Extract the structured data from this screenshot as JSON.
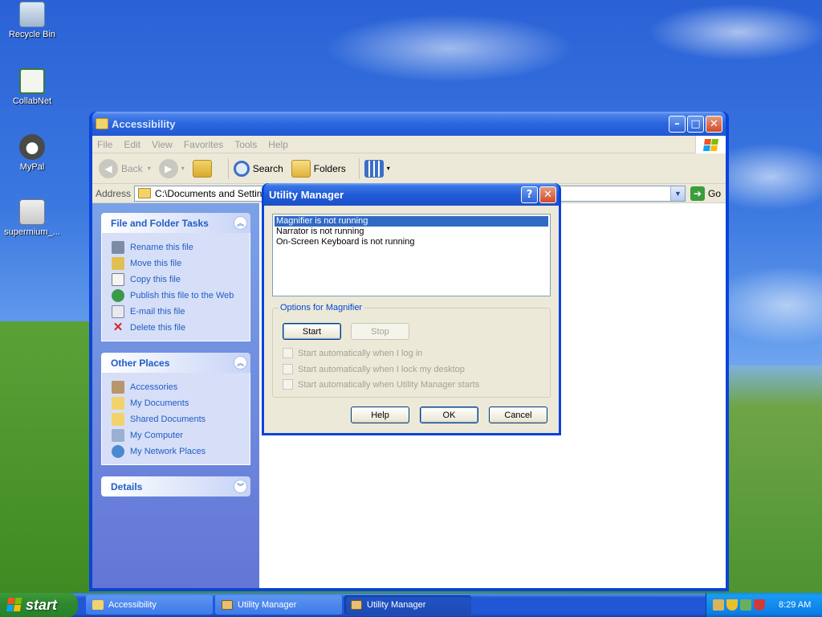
{
  "desktop": {
    "icons": [
      {
        "label": "Recycle Bin"
      },
      {
        "label": "CollabNet"
      },
      {
        "label": "MyPal"
      },
      {
        "label": "supermium_..."
      }
    ]
  },
  "explorer": {
    "title": "Accessibility",
    "menu": [
      "File",
      "Edit",
      "View",
      "Favorites",
      "Tools",
      "Help"
    ],
    "toolbar": {
      "back": "Back",
      "search": "Search",
      "folders": "Folders"
    },
    "address": {
      "label": "Address",
      "value": "C:\\Documents and Settings\\A",
      "go": "Go"
    },
    "tasks": {
      "title": "File and Folder Tasks",
      "items": [
        "Rename this file",
        "Move this file",
        "Copy this file",
        "Publish this file to the Web",
        "E-mail this file",
        "Delete this file"
      ]
    },
    "places": {
      "title": "Other Places",
      "items": [
        "Accessories",
        "My Documents",
        "Shared Documents",
        "My Computer",
        "My Network Places"
      ]
    },
    "details": {
      "title": "Details"
    }
  },
  "dialog": {
    "title": "Utility Manager",
    "list": [
      "Magnifier is not running",
      "Narrator is not running",
      "On-Screen Keyboard is not running"
    ],
    "options_label": "Options for Magnifier",
    "start": "Start",
    "stop": "Stop",
    "checks": [
      "Start automatically when I log in",
      "Start automatically when I lock my desktop",
      "Start automatically when Utility Manager starts"
    ],
    "help": "Help",
    "ok": "OK",
    "cancel": "Cancel"
  },
  "taskbar": {
    "start": "start",
    "tasks": [
      "Accessibility",
      "Utility Manager",
      "Utility Manager"
    ],
    "time": "8:29 AM"
  }
}
